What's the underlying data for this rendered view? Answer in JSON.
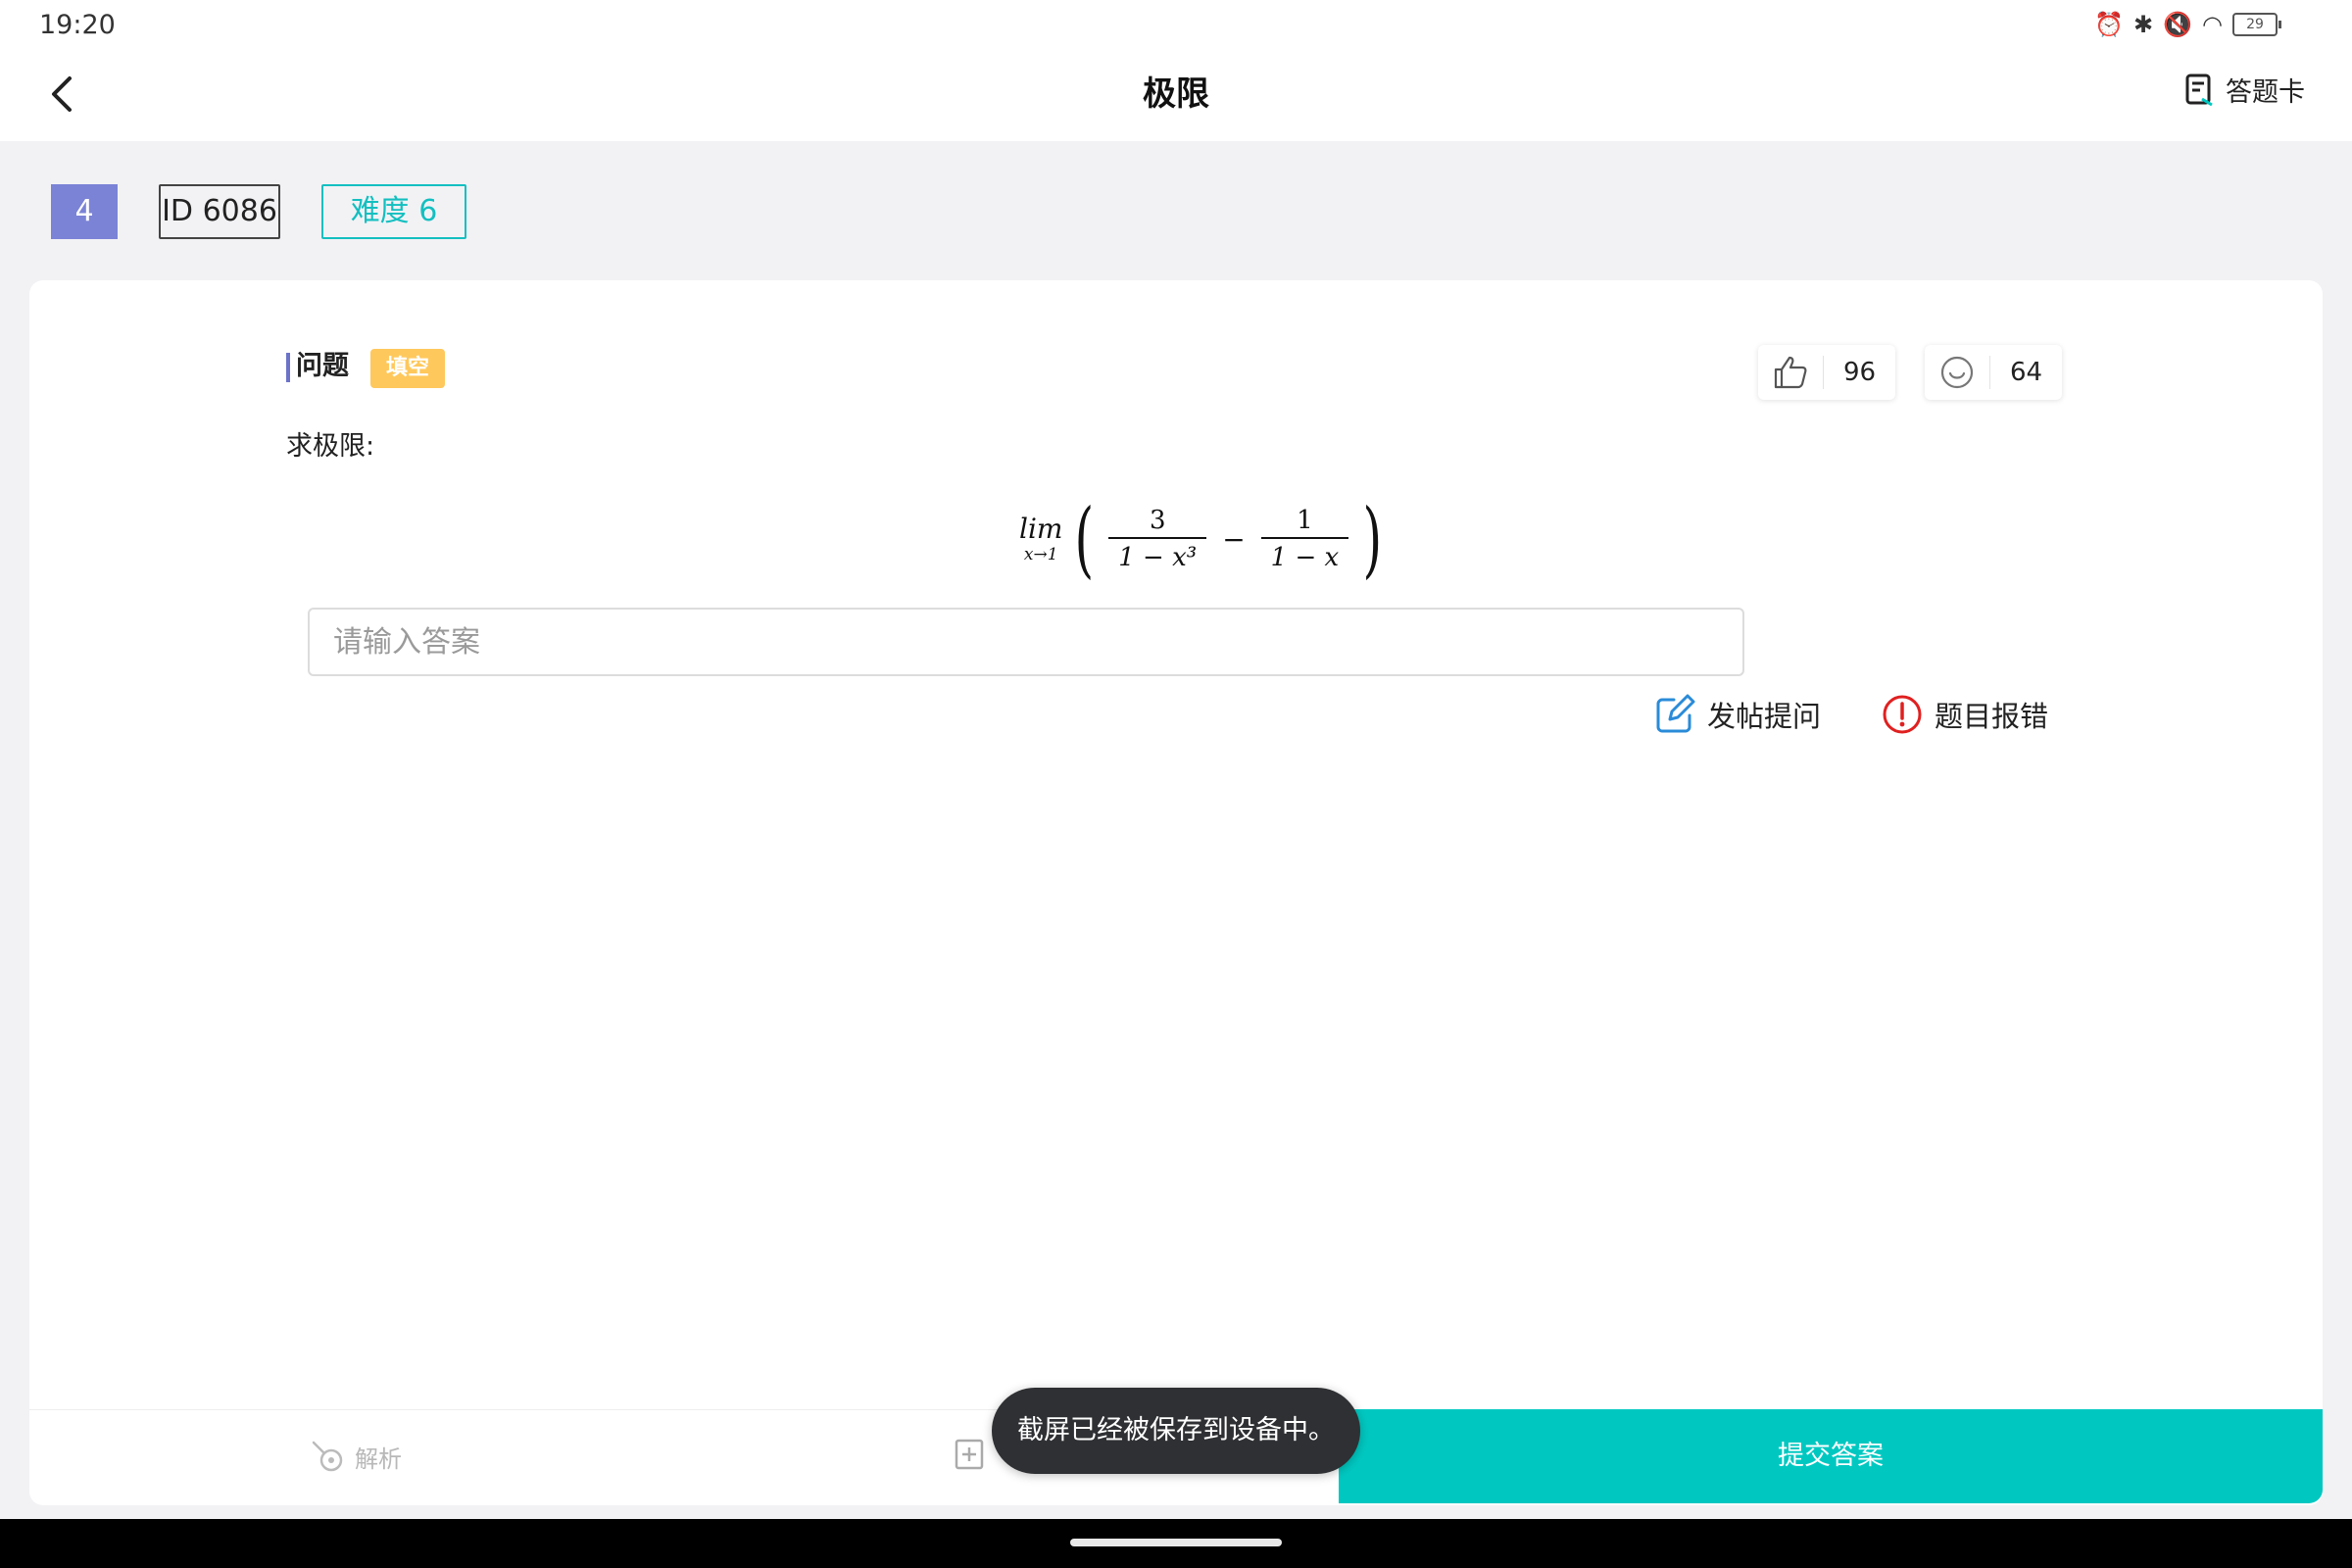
{
  "status": {
    "time": "19:20",
    "battery": "29"
  },
  "header": {
    "title": "极限",
    "answer_card_label": "答题卡"
  },
  "tags": {
    "number": "4",
    "id": "ID 6086",
    "difficulty": "难度 6"
  },
  "question": {
    "section_label": "问题",
    "type_badge": "填空",
    "prompt": "求极限:",
    "formula": {
      "lim": "lim",
      "sub": "x→1",
      "frac1_num": "3",
      "frac1_den": "1 − x³",
      "op": "−",
      "frac2_num": "1",
      "frac2_den": "1 − x"
    }
  },
  "stats": {
    "likes": "96",
    "emoji_count": "64"
  },
  "answer": {
    "placeholder": "请输入答案"
  },
  "actions": {
    "post_question": "发帖提问",
    "report_error": "题目报错"
  },
  "bottom": {
    "analysis_label": "解析",
    "submit_label": "提交答案"
  },
  "toast": {
    "message": "截屏已经被保存到设备中。"
  },
  "colors": {
    "accent": "#00c8c1",
    "tag_num_bg": "#7b83d6",
    "badge_bg": "#ffc85c",
    "report_red": "#e02020",
    "post_blue": "#2a8bd8"
  }
}
